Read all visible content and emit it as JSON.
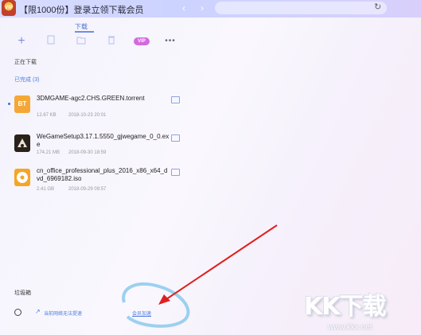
{
  "titlebar": {
    "logo_text": "VIP",
    "promo_text": "【限1000份】登录立领下载会员"
  },
  "panel": {
    "tab_label": "下载",
    "toolbar": {
      "vip_label": "VIP"
    },
    "downloading_label": "正在下载",
    "completed_label": "已完成 (3)",
    "items": [
      {
        "name": "3DMGAME-agc2.CHS.GREEN.torrent",
        "size": "12.67 KB",
        "date": "2018-10-23 20:01",
        "icon": "bt-icon",
        "icon_text": "BT"
      },
      {
        "name": "WeGameSetup3.17.1.5550_gjwegame_0_0.exe",
        "size": "174.21 MB",
        "date": "2018-09-30 18:59",
        "icon": "wegame-icon"
      },
      {
        "name": "cn_office_professional_plus_2016_x86_x64_dvd_6969182.iso",
        "size": "2.41 GB",
        "date": "2018-09-29 09:57",
        "icon": "iso-disc-icon"
      }
    ],
    "footer_label": "垃圾箱",
    "network_status": "当前网络无法提速",
    "speed_link": "会员加速"
  },
  "watermark": {
    "logo": "KK下载",
    "url": "www.kkx.net"
  },
  "colors": {
    "accent": "#4c7fe0",
    "vip": "#d46ae0",
    "arrow": "#e02020"
  }
}
